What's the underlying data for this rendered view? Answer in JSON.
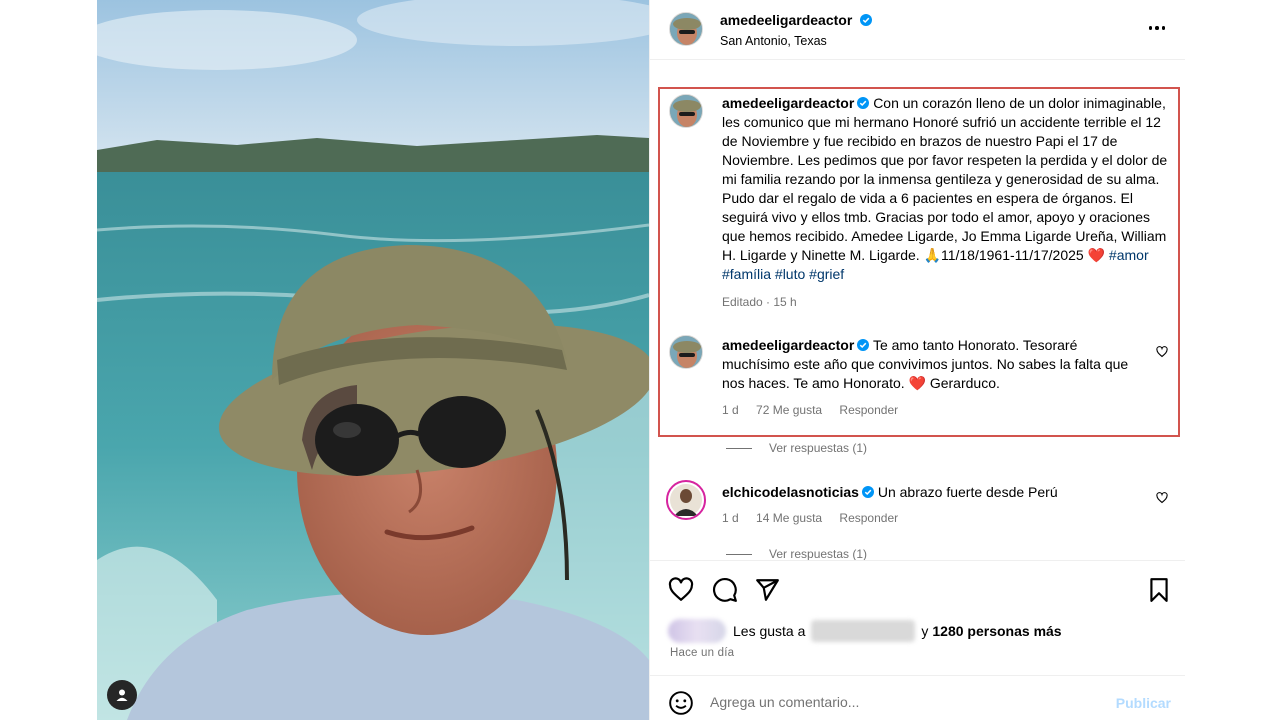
{
  "post": {
    "author": "amedeeligardeactor",
    "location": "San Antonio, Texas"
  },
  "caption": {
    "author": "amedeeligardeactor",
    "text": "Con un corazón lleno de un dolor inimaginable, les comunico que mi hermano Honoré sufrió un accidente terrible el 12 de Noviembre y fue recibido en brazos de nuestro Papi el 17 de Noviembre. Les pedimos que por favor respeten la perdida y el dolor de mi familia rezando por la inmensa gentileza y generosidad de su alma. Pudo dar el regalo de vida a 6 pacientes en espera de órganos. El seguirá vivo y ellos tmb. Gracias por todo el amor, apoyo y oraciones que hemos recibido. Amedee Ligarde, Jo Emma Ligarde Ureña, William H. Ligarde y Ninette M. Ligarde. 🙏11/18/1961-11/17/2025 ❤️",
    "hashtags": "#amor #família #luto #grief",
    "edited": "Editado · 15 h"
  },
  "comments": [
    {
      "author": "amedeeligardeactor",
      "text": "Te amo tanto Honorato. Tesoraré muchísimo este año que convivimos juntos. No sabes la falta que nos haces. Te amo Honorato. ❤️ Gerarduco.",
      "time": "1 d",
      "likes": "72 Me gusta",
      "reply": "Responder",
      "view_replies": "Ver respuestas (1)"
    },
    {
      "author": "elchicodelasnoticias",
      "text": "Un abrazo fuerte desde Perú",
      "time": "1 d",
      "likes": "14 Me gusta",
      "reply": "Responder",
      "view_replies": "Ver respuestas (1)"
    }
  ],
  "likes": {
    "prefix": "Les gusta a",
    "suffix": "y",
    "others": "1280 personas más"
  },
  "time_ago": "Hace un día",
  "comment_box": {
    "placeholder": "Agrega un comentario...",
    "publish": "Publicar"
  },
  "colors": {
    "highlight_border": "#d2544e",
    "verified_badge": "#0095f6",
    "heart_red": "#e8386b",
    "hashtag": "#00376b",
    "publish_disabled": "#b3dbff"
  },
  "icons": [
    "verified-badge-icon",
    "more-options-icon",
    "heart-icon",
    "comment-icon",
    "share-icon",
    "bookmark-icon",
    "emoji-icon",
    "user-tag-icon"
  ]
}
